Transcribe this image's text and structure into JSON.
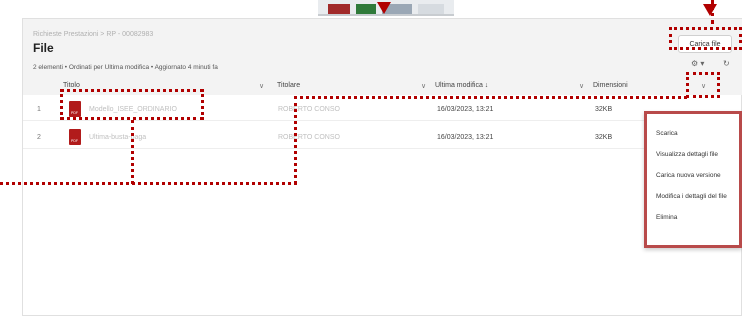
{
  "header": {
    "breadcrumb": "Richieste Prestazioni > RP - 00082983",
    "title": "File",
    "meta": "2 elementi • Ordinati per Ultima modifica • Aggiornato 4 minuti fa",
    "upload_label": "Carica file"
  },
  "columns": [
    {
      "label": "Titolo"
    },
    {
      "label": "Titolare"
    },
    {
      "label": "Ultima modifica ↓"
    },
    {
      "label": "Dimensioni"
    }
  ],
  "rows": [
    {
      "num": "1",
      "name": "Modello_ISEE_ORDINARIO",
      "owner": "ROBERTO CONSO",
      "modified": "16/03/2023, 13:21",
      "size": "32KB"
    },
    {
      "num": "2",
      "name": "Ultima-busta-paga",
      "owner": "ROBERTO CONSO",
      "modified": "16/03/2023, 13:21",
      "size": "32KB"
    }
  ],
  "file_icon_text": "PDF",
  "menu": {
    "items": [
      "Scarica",
      "Visualizza dettagli file",
      "Carica nuova versione",
      "Modifica i dettagli del file",
      "Elimina"
    ]
  },
  "icons": {
    "gear": "⚙ ▾",
    "refresh": "↻",
    "chevron": "∨"
  },
  "colors": {
    "annotation": "#b10000",
    "pdf": "#b11b1b"
  }
}
